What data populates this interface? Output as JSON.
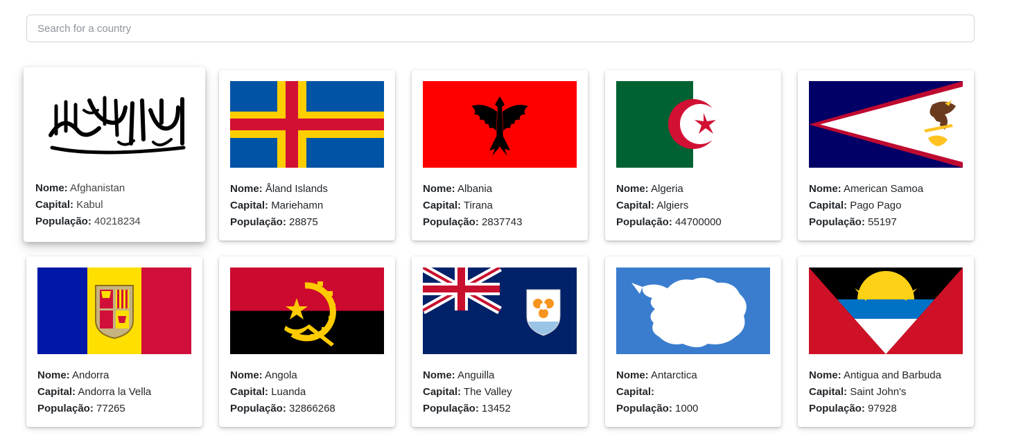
{
  "search": {
    "placeholder": "Search for a country",
    "value": ""
  },
  "labels": {
    "name": "Nome:",
    "capital": "Capital:",
    "population": "População:"
  },
  "countries": [
    {
      "name": "Afghanistan",
      "capital": "Kabul",
      "population": "40218234",
      "flag_icon": "afghanistan-flag"
    },
    {
      "name": "Åland Islands",
      "capital": "Mariehamn",
      "population": "28875",
      "flag_icon": "aland-islands-flag"
    },
    {
      "name": "Albania",
      "capital": "Tirana",
      "population": "2837743",
      "flag_icon": "albania-flag"
    },
    {
      "name": "Algeria",
      "capital": "Algiers",
      "population": "44700000",
      "flag_icon": "algeria-flag"
    },
    {
      "name": "American Samoa",
      "capital": "Pago Pago",
      "population": "55197",
      "flag_icon": "american-samoa-flag"
    },
    {
      "name": "Andorra",
      "capital": "Andorra la Vella",
      "population": "77265",
      "flag_icon": "andorra-flag"
    },
    {
      "name": "Angola",
      "capital": "Luanda",
      "population": "32866268",
      "flag_icon": "angola-flag"
    },
    {
      "name": "Anguilla",
      "capital": "The Valley",
      "population": "13452",
      "flag_icon": "anguilla-flag"
    },
    {
      "name": "Antarctica",
      "capital": "",
      "population": "1000",
      "flag_icon": "antarctica-flag"
    },
    {
      "name": "Antigua and Barbuda",
      "capital": "Saint John's",
      "population": "97928",
      "flag_icon": "antigua-and-barbuda-flag"
    }
  ]
}
